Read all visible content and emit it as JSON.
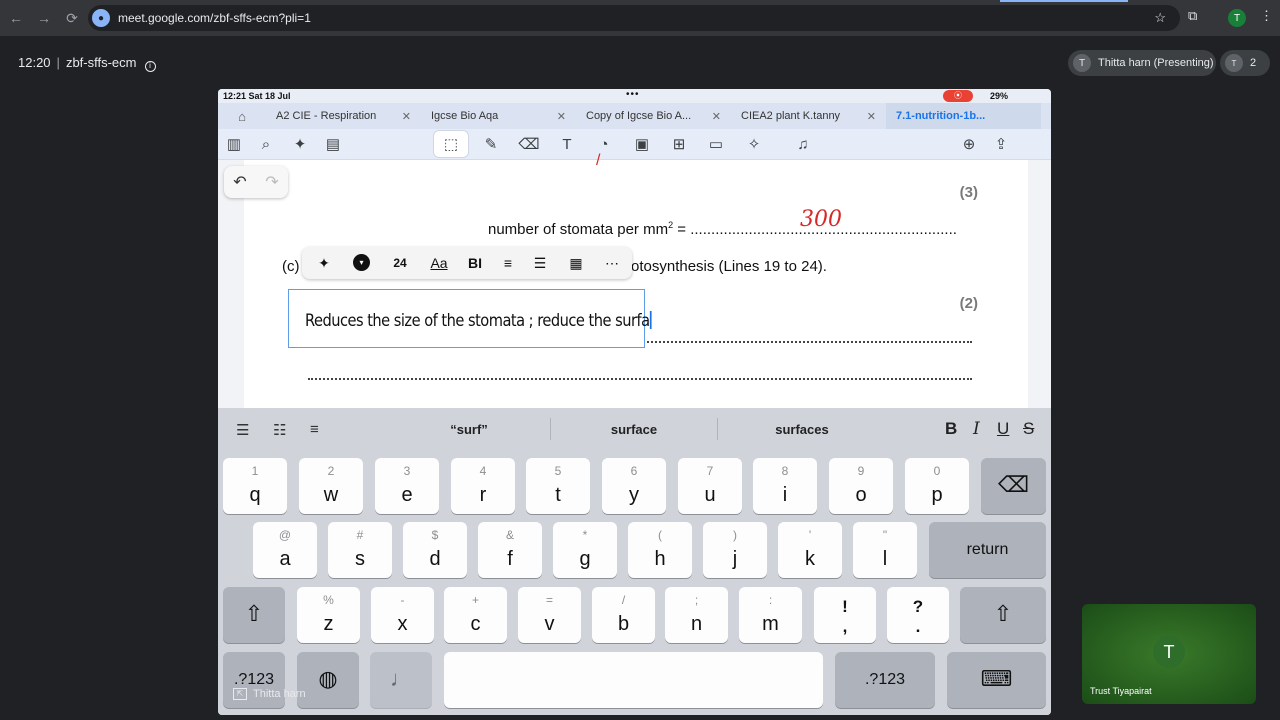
{
  "browser": {
    "url": "meet.google.com/zbf-sffs-ecm?pli=1",
    "profile_initial": "T"
  },
  "meet": {
    "time": "12:20",
    "code": "zbf-sffs-ecm",
    "presenter": "Thitta harn (Presenting)",
    "presenter_initial": "T",
    "participant_count": "2",
    "self_name": "Thitta harn",
    "tile_name": "Trust Tiyapairat",
    "tile_initial": "T"
  },
  "ipad": {
    "status_time": "12:21  Sat 18 Jul",
    "battery": "29%",
    "tabs": [
      {
        "label": "A2 CIE - Respiration"
      },
      {
        "label": "Igcse Bio Aqa"
      },
      {
        "label": "Copy of Igcse Bio A..."
      },
      {
        "label": "CIEA2 plant K.tanny"
      },
      {
        "label": "7.1-nutrition-1b..."
      }
    ],
    "font_size": "24"
  },
  "document": {
    "marks_3": "(3)",
    "stomata_line": "number of stomata per mm",
    "stomata_sup": "2",
    "stomata_eq": " = ",
    "stomata_dots": "................................................................",
    "handwritten_value": "300",
    "part_c": "(c)",
    "question_tail": "otosynthesis (Lines 19 to 24).",
    "marks_2": "(2)",
    "typed_answer": "Reduces the size of the stomata ; reduce the surfa"
  },
  "keyboard": {
    "suggestions": [
      "“surf”",
      "surface",
      "surfaces"
    ],
    "row1": [
      {
        "hint": "1",
        "ch": "q"
      },
      {
        "hint": "2",
        "ch": "w"
      },
      {
        "hint": "3",
        "ch": "e"
      },
      {
        "hint": "4",
        "ch": "r"
      },
      {
        "hint": "5",
        "ch": "t"
      },
      {
        "hint": "6",
        "ch": "y"
      },
      {
        "hint": "7",
        "ch": "u"
      },
      {
        "hint": "8",
        "ch": "i"
      },
      {
        "hint": "9",
        "ch": "o"
      },
      {
        "hint": "0",
        "ch": "p"
      }
    ],
    "row2": [
      {
        "hint": "@",
        "ch": "a"
      },
      {
        "hint": "#",
        "ch": "s"
      },
      {
        "hint": "$",
        "ch": "d"
      },
      {
        "hint": "&",
        "ch": "f"
      },
      {
        "hint": "*",
        "ch": "g"
      },
      {
        "hint": "(",
        "ch": "h"
      },
      {
        "hint": ")",
        "ch": "j"
      },
      {
        "hint": "'",
        "ch": "k"
      },
      {
        "hint": "\"",
        "ch": "l"
      }
    ],
    "row3": [
      {
        "hint": "%",
        "ch": "z"
      },
      {
        "hint": "-",
        "ch": "x"
      },
      {
        "hint": "+",
        "ch": "c"
      },
      {
        "hint": "=",
        "ch": "v"
      },
      {
        "hint": "/",
        "ch": "b"
      },
      {
        "hint": ";",
        "ch": "n"
      },
      {
        "hint": ":",
        "ch": "m"
      }
    ],
    "exclaim_top": "!",
    "exclaim_bottom": ",",
    "question_top": "?",
    "question_bottom": ".",
    "return_label": "return",
    "numbers_label": ".?123"
  }
}
